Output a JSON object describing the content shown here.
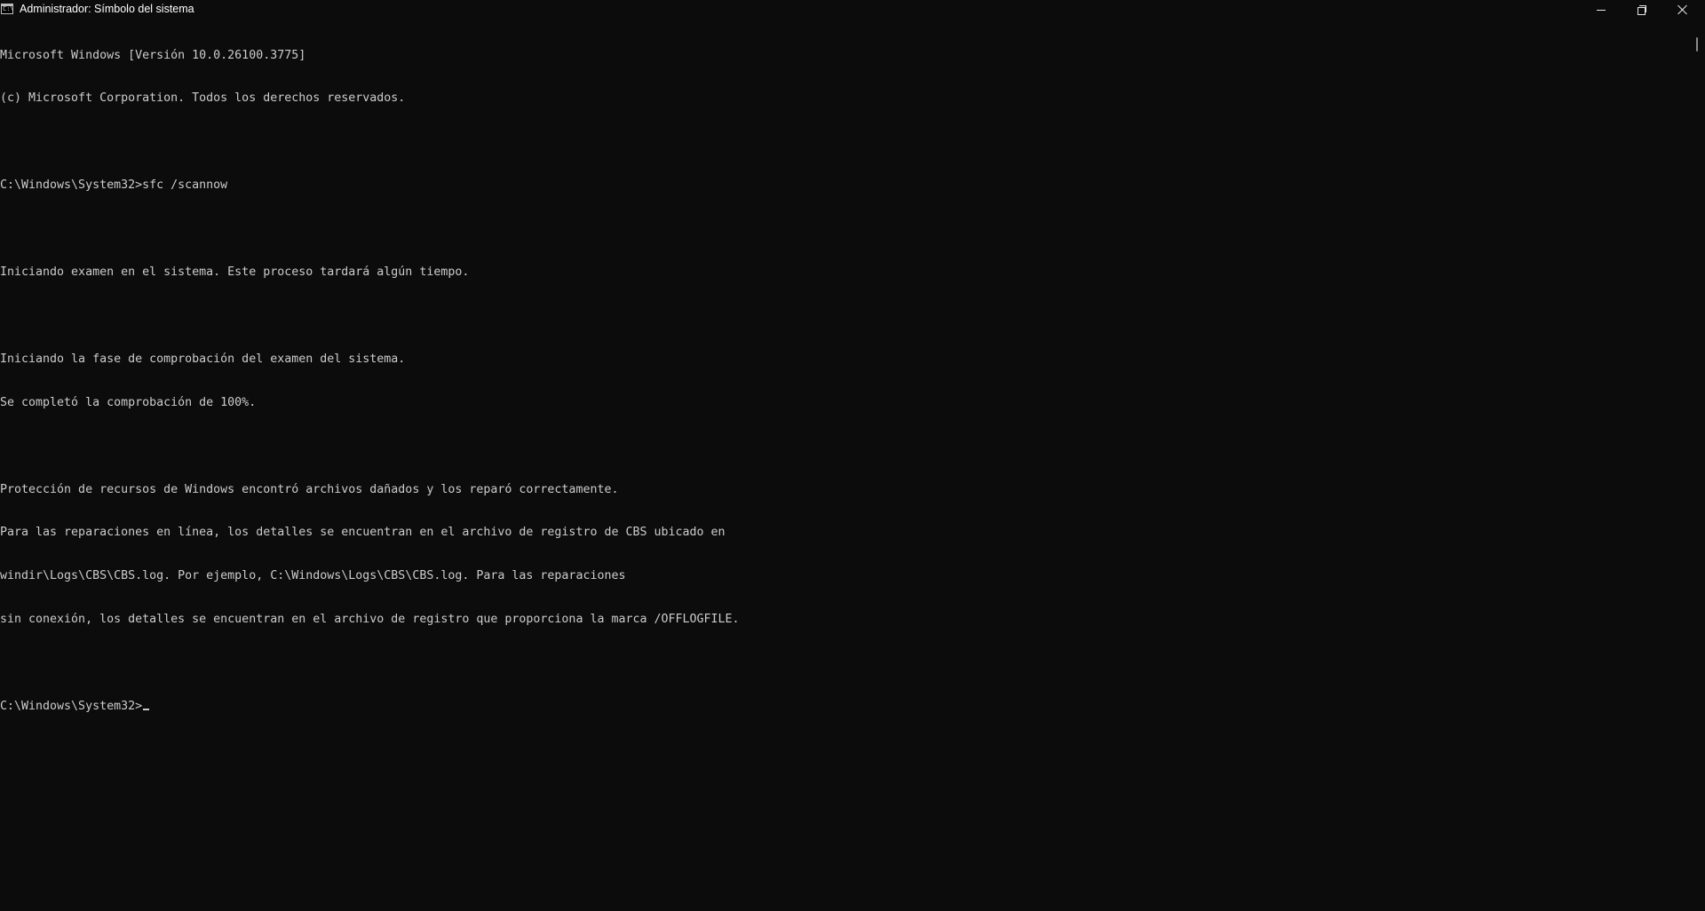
{
  "window": {
    "title": "Administrador: Símbolo del sistema",
    "icon": "cmd-icon",
    "icon_glyph": "C:\\"
  },
  "caption_buttons": {
    "minimize": "minimize-icon",
    "restore": "restore-icon",
    "close": "close-icon"
  },
  "console": {
    "background": "#0c0c0c",
    "foreground": "#cccccc",
    "lines": [
      "Microsoft Windows [Versión 10.0.26100.3775]",
      "(c) Microsoft Corporation. Todos los derechos reservados.",
      "",
      "C:\\Windows\\System32>sfc /scannow",
      "",
      "Iniciando examen en el sistema. Este proceso tardará algún tiempo.",
      "",
      "Iniciando la fase de comprobación del examen del sistema.",
      "Se completó la comprobación de 100%.",
      "",
      "Protección de recursos de Windows encontró archivos dañados y los reparó correctamente.",
      "Para las reparaciones en línea, los detalles se encuentran en el archivo de registro de CBS ubicado en",
      "windir\\Logs\\CBS\\CBS.log. Por ejemplo, C:\\Windows\\Logs\\CBS\\CBS.log. Para las reparaciones",
      "sin conexión, los detalles se encuentran en el archivo de registro que proporciona la marca /OFFLOGFILE.",
      ""
    ],
    "prompt": "C:\\Windows\\System32>"
  }
}
